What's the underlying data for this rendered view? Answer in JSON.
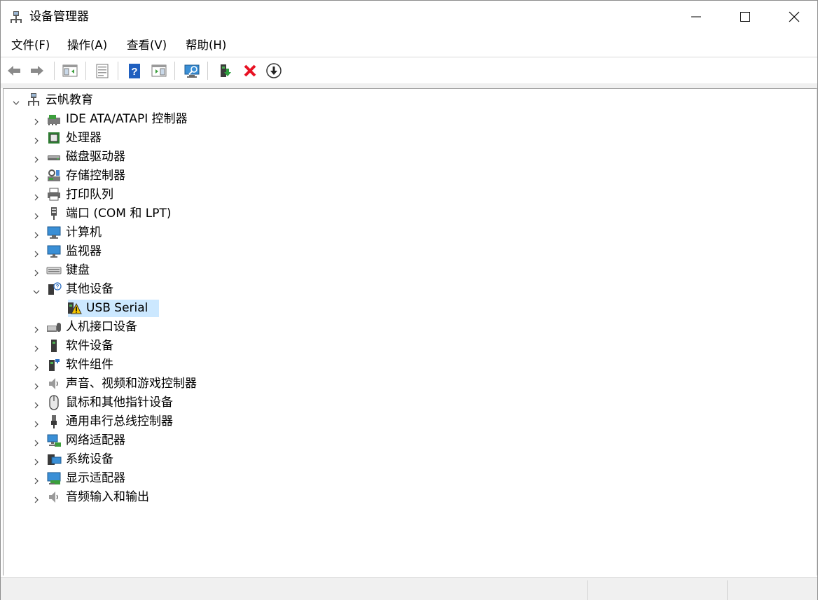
{
  "window": {
    "title": "设备管理器",
    "controls": {
      "minimize": "minimize",
      "maximize": "maximize",
      "close": "close"
    }
  },
  "menu": [
    {
      "label": "文件(F)"
    },
    {
      "label": "操作(A)"
    },
    {
      "label": "查看(V)"
    },
    {
      "label": "帮助(H)"
    }
  ],
  "toolbar": {
    "buttons": [
      "back-icon",
      "forward-icon",
      "show-hide-console-tree-icon",
      "properties-icon",
      "help-icon",
      "action-pane-icon",
      "scan-hardware-icon",
      "update-driver-icon",
      "uninstall-device-icon",
      "disable-device-icon"
    ]
  },
  "tree": {
    "root": {
      "label": "云帆教育",
      "expanded": true,
      "icon": "computer-root-icon"
    },
    "categories": [
      {
        "label": "IDE ATA/ATAPI 控制器",
        "icon": "ide-controller-icon",
        "expanded": false
      },
      {
        "label": "处理器",
        "icon": "processor-icon",
        "expanded": false
      },
      {
        "label": "磁盘驱动器",
        "icon": "disk-drive-icon",
        "expanded": false
      },
      {
        "label": "存储控制器",
        "icon": "storage-controller-icon",
        "expanded": false
      },
      {
        "label": "打印队列",
        "icon": "printer-icon",
        "expanded": false
      },
      {
        "label": "端口 (COM 和 LPT)",
        "icon": "port-icon",
        "expanded": false
      },
      {
        "label": "计算机",
        "icon": "computer-icon",
        "expanded": false
      },
      {
        "label": "监视器",
        "icon": "monitor-icon",
        "expanded": false
      },
      {
        "label": "键盘",
        "icon": "keyboard-icon",
        "expanded": false
      },
      {
        "label": "其他设备",
        "icon": "other-devices-icon",
        "expanded": true,
        "children": [
          {
            "label": "USB Serial",
            "icon": "warning-device-icon",
            "selected": true
          }
        ]
      },
      {
        "label": "人机接口设备",
        "icon": "hid-icon",
        "expanded": false
      },
      {
        "label": "软件设备",
        "icon": "software-device-icon",
        "expanded": false
      },
      {
        "label": "软件组件",
        "icon": "software-component-icon",
        "expanded": false
      },
      {
        "label": "声音、视频和游戏控制器",
        "icon": "sound-icon",
        "expanded": false
      },
      {
        "label": "鼠标和其他指针设备",
        "icon": "mouse-icon",
        "expanded": false
      },
      {
        "label": "通用串行总线控制器",
        "icon": "usb-icon",
        "expanded": false
      },
      {
        "label": "网络适配器",
        "icon": "network-adapter-icon",
        "expanded": false
      },
      {
        "label": "系统设备",
        "icon": "system-device-icon",
        "expanded": false
      },
      {
        "label": "显示适配器",
        "icon": "display-adapter-icon",
        "expanded": false
      },
      {
        "label": "音频输入和输出",
        "icon": "audio-io-icon",
        "expanded": false
      }
    ]
  },
  "colors": {
    "selection": "#cce8ff",
    "accent": "#0078d7",
    "warning": "#f5c400",
    "delete": "#e81123"
  }
}
